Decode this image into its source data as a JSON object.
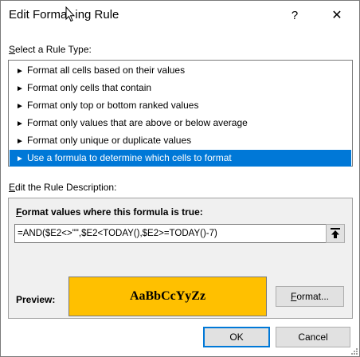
{
  "window": {
    "title_pre": "Edit Forma",
    "title_post": "ing Rule",
    "help_glyph": "?",
    "close_glyph": "✕"
  },
  "rule_type": {
    "label_ul": "S",
    "label_rest": "elect a Rule Type:",
    "items": [
      {
        "label": "Format all cells based on their values",
        "selected": false
      },
      {
        "label": "Format only cells that contain",
        "selected": false
      },
      {
        "label": "Format only top or bottom ranked values",
        "selected": false
      },
      {
        "label": "Format only values that are above or below average",
        "selected": false
      },
      {
        "label": "Format only unique or duplicate values",
        "selected": false
      },
      {
        "label": "Use a formula to determine which cells to format",
        "selected": true
      }
    ]
  },
  "description": {
    "label_ul": "E",
    "label_rest": "dit the Rule Description:",
    "formula_label_ul": "F",
    "formula_label_rest": "ormat values where this formula is true:",
    "formula_value": "=AND($E2<>\"\",$E2<TODAY(),$E2>=TODAY()-7)",
    "preview_label": "Preview:",
    "preview_sample": "AaBbCcYyZz",
    "preview_fill_color": "#FFC000",
    "format_button_ul": "F",
    "format_button_rest": "ormat..."
  },
  "buttons": {
    "ok": "OK",
    "cancel": "Cancel"
  },
  "colors": {
    "selection": "#0078D7"
  }
}
